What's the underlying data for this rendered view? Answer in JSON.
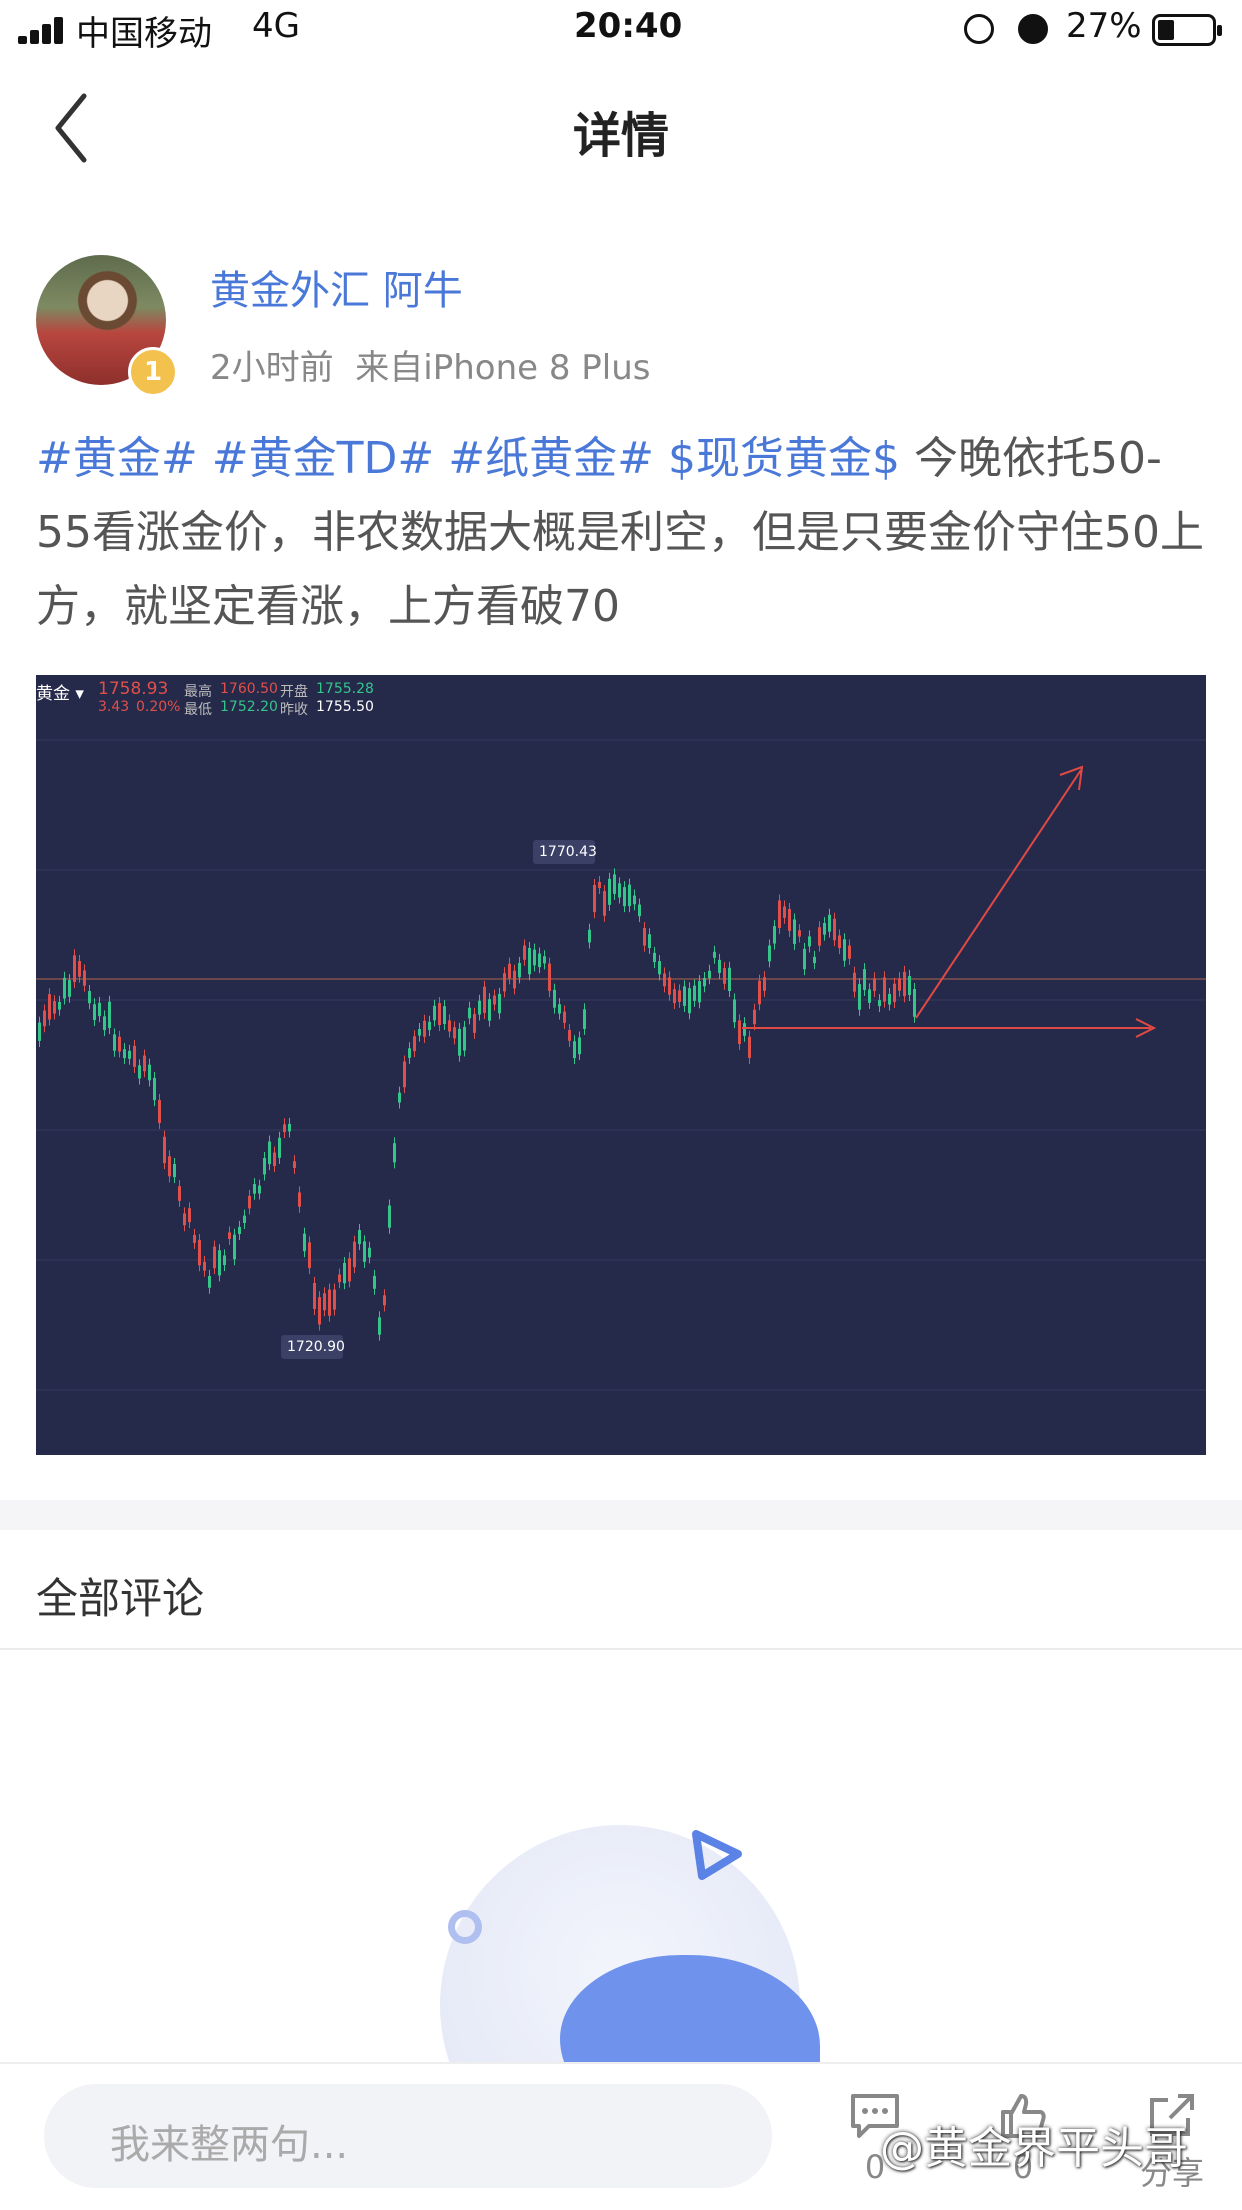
{
  "status_bar": {
    "carrier": "中国移动",
    "network": "4G",
    "time": "20:40",
    "battery": "27%"
  },
  "nav": {
    "back_icon": "chevron-left-icon",
    "title": "详情"
  },
  "author": {
    "name": "黄金外汇 阿牛",
    "level": "1",
    "time": "2小时前",
    "source": "来自iPhone 8 Plus"
  },
  "post": {
    "tags": [
      "#黄金#",
      "#黄金TD#",
      "#纸黄金#",
      "$现货黄金$"
    ],
    "text": "今晚依托50-55看涨金价，非农数据大概是利空，但是只要金价守住50上方，就坚定看涨，上方看破70"
  },
  "chart_image": {
    "symbol": "黄金",
    "price": "1758.93",
    "change": "3.43",
    "change_pct": "0.20%",
    "high_label": "最高",
    "high": "1760.50",
    "open_label": "开盘",
    "open": "1755.28",
    "low_label": "最低",
    "low": "1752.20",
    "prev_label": "昨收",
    "prev": "1755.50",
    "peak_label": "1770.43",
    "trough_label": "1720.90",
    "colors": {
      "up": "#e0504a",
      "down": "#35c58a",
      "bg": "#25294a"
    }
  },
  "comments": {
    "title": "全部评论"
  },
  "bottom_bar": {
    "input_placeholder": "我来整两句...",
    "comment_count": "0",
    "like_count": "0",
    "share_label": "分享",
    "watermark": "@黄金界平头哥"
  }
}
